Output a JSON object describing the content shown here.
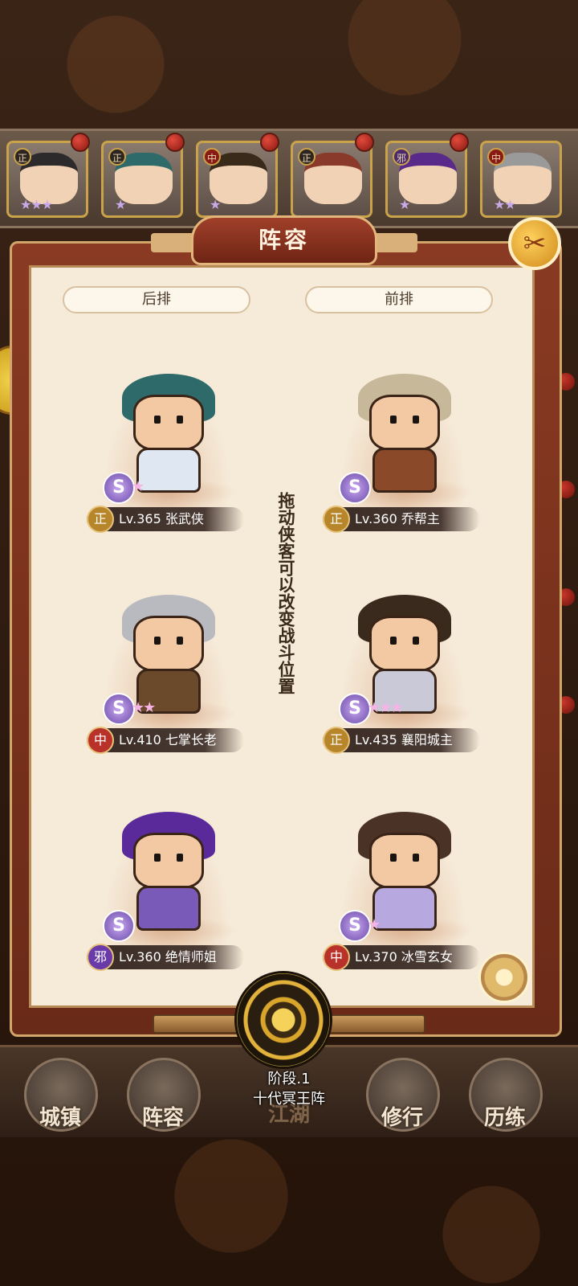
{
  "hero_strip": [
    {
      "faction": "正",
      "stars": "★★★"
    },
    {
      "faction": "正",
      "stars": "★"
    },
    {
      "faction": "中",
      "stars": "★"
    },
    {
      "faction": "正",
      "stars": ""
    },
    {
      "faction": "邪",
      "stars": "★"
    },
    {
      "faction": "中",
      "stars": "★★"
    }
  ],
  "modal": {
    "title": "阵容",
    "close_icon": "✂",
    "back_row_label": "后排",
    "front_row_label": "前排",
    "hint": "拖动侠客可以改变战斗位置"
  },
  "slots": {
    "back": [
      {
        "faction": "正",
        "name": "Lv.365 张武侠",
        "badge": "S",
        "stars": "★"
      },
      {
        "faction": "中",
        "name": "Lv.410 七掌长老",
        "badge": "S",
        "stars": "★★"
      },
      {
        "faction": "邪",
        "name": "Lv.360 绝情师姐",
        "badge": "S",
        "stars": ""
      }
    ],
    "front": [
      {
        "faction": "正",
        "name": "Lv.360 乔帮主",
        "badge": "S",
        "stars": ""
      },
      {
        "faction": "正",
        "name": "Lv.435 襄阳城主",
        "badge": "S",
        "stars": "★★★"
      },
      {
        "faction": "中",
        "name": "Lv.370 冰雪玄女",
        "badge": "S",
        "stars": "★"
      }
    ]
  },
  "formation": {
    "stage": "阶段.1",
    "name": "十代冥王阵"
  },
  "bottom_nav": [
    {
      "label": "城镇"
    },
    {
      "label": "阵容"
    },
    {
      "label": "江湖"
    },
    {
      "label": "修行"
    },
    {
      "label": "历练"
    }
  ],
  "colors": {
    "faction_zheng": "#b8862a",
    "faction_zhong": "#b8322a",
    "faction_xie": "#6a3aa8"
  }
}
